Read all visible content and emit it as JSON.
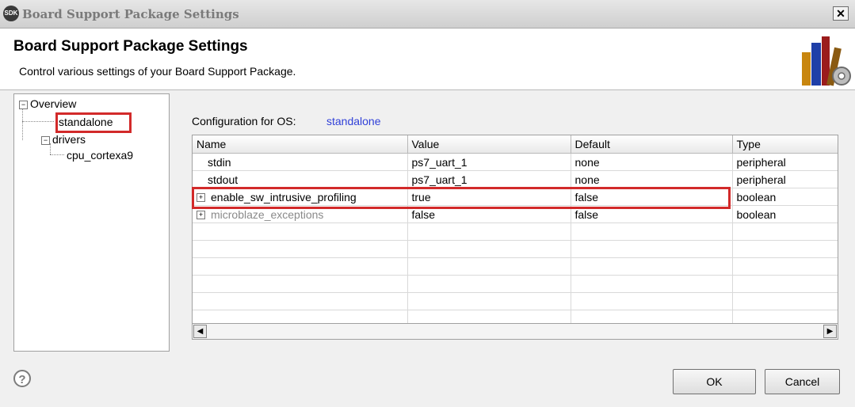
{
  "window": {
    "title": "Board Support Package Settings",
    "app_icon": "SDK"
  },
  "header": {
    "title": "Board Support Package Settings",
    "description": "Control various settings of your Board Support Package."
  },
  "tree": {
    "items": [
      {
        "label": "Overview",
        "expand": "−"
      },
      {
        "label": "standalone"
      },
      {
        "label": "drivers",
        "expand": "−"
      },
      {
        "label": "cpu_cortexa9"
      }
    ]
  },
  "config": {
    "label": "Configuration for OS:",
    "os": "standalone"
  },
  "table": {
    "columns": [
      "Name",
      "Value",
      "Default",
      "Type"
    ],
    "rows": [
      {
        "name": "stdin",
        "value": "ps7_uart_1",
        "default": "none",
        "type": "peripheral"
      },
      {
        "name": "stdout",
        "value": "ps7_uart_1",
        "default": "none",
        "type": "peripheral"
      },
      {
        "name": "enable_sw_intrusive_profiling",
        "value": "true",
        "default": "false",
        "type": "boolean",
        "expand": "+"
      },
      {
        "name": "microblaze_exceptions",
        "value": "false",
        "default": "false",
        "type": "boolean",
        "expand": "+"
      }
    ]
  },
  "footer": {
    "help": "?",
    "ok": "OK",
    "cancel": "Cancel"
  },
  "colors": {
    "highlight": "#d22a2a",
    "link": "#2f3fd8"
  }
}
